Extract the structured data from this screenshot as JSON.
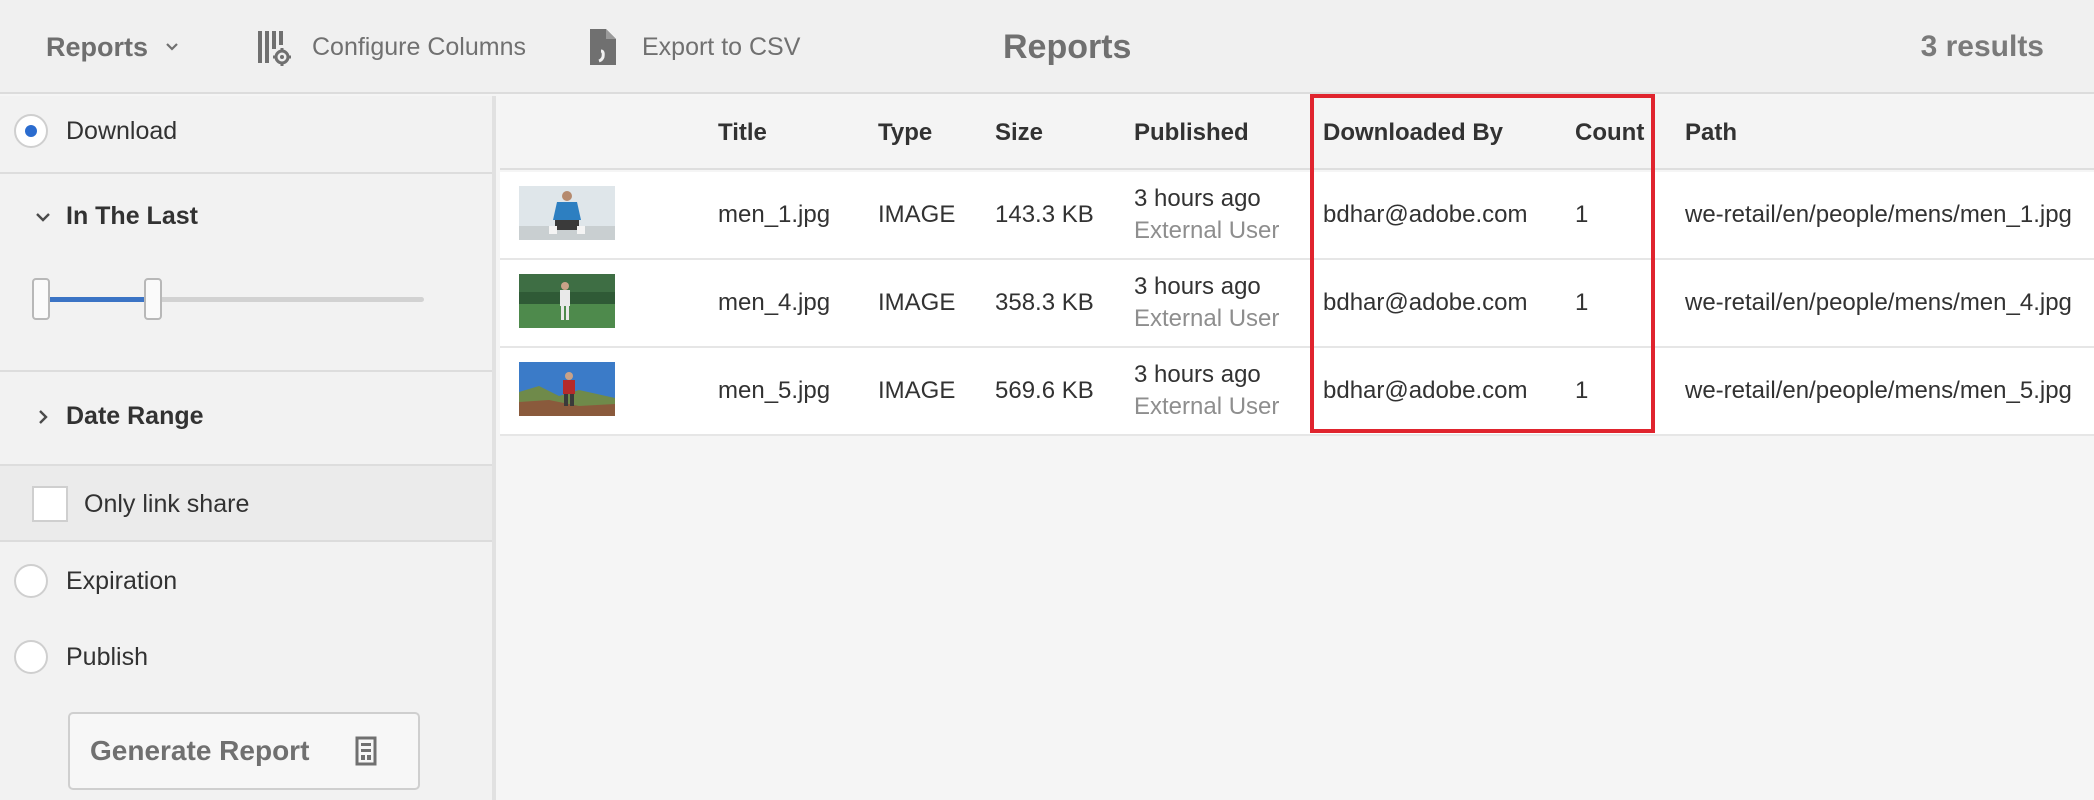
{
  "toolbar": {
    "reports_menu_label": "Reports",
    "configure_columns_label": "Configure Columns",
    "export_label": "Export to CSV",
    "page_title": "Reports",
    "results_count": "3 results"
  },
  "rail": {
    "download_label": "Download",
    "download_selected": true,
    "in_the_last_label": "In The Last",
    "slider_value_fraction": 0.3,
    "date_range_label": "Date Range",
    "only_link_share_label": "Only link share",
    "expiration_label": "Expiration",
    "publish_label": "Publish",
    "generate_report_label": "Generate Report"
  },
  "table": {
    "columns": [
      "Title",
      "Type",
      "Size",
      "Published",
      "Downloaded By",
      "Count",
      "Path"
    ],
    "rows": [
      {
        "title": "men_1.jpg",
        "type": "IMAGE",
        "size": "143.3 KB",
        "published": "3 hours ago",
        "published_by": "External User",
        "downloaded_by": "bdhar@adobe.com",
        "count": "1",
        "path": "we-retail/en/people/mens/men_1.jpg"
      },
      {
        "title": "men_4.jpg",
        "type": "IMAGE",
        "size": "358.3 KB",
        "published": "3 hours ago",
        "published_by": "External User",
        "downloaded_by": "bdhar@adobe.com",
        "count": "1",
        "path": "we-retail/en/people/mens/men_4.jpg"
      },
      {
        "title": "men_5.jpg",
        "type": "IMAGE",
        "size": "569.6 KB",
        "published": "3 hours ago",
        "published_by": "External User",
        "downloaded_by": "bdhar@adobe.com",
        "count": "1",
        "path": "we-retail/en/people/mens/men_5.jpg"
      }
    ]
  },
  "colors": {
    "accent": "#2b6ccf",
    "highlight": "#e0242e"
  }
}
